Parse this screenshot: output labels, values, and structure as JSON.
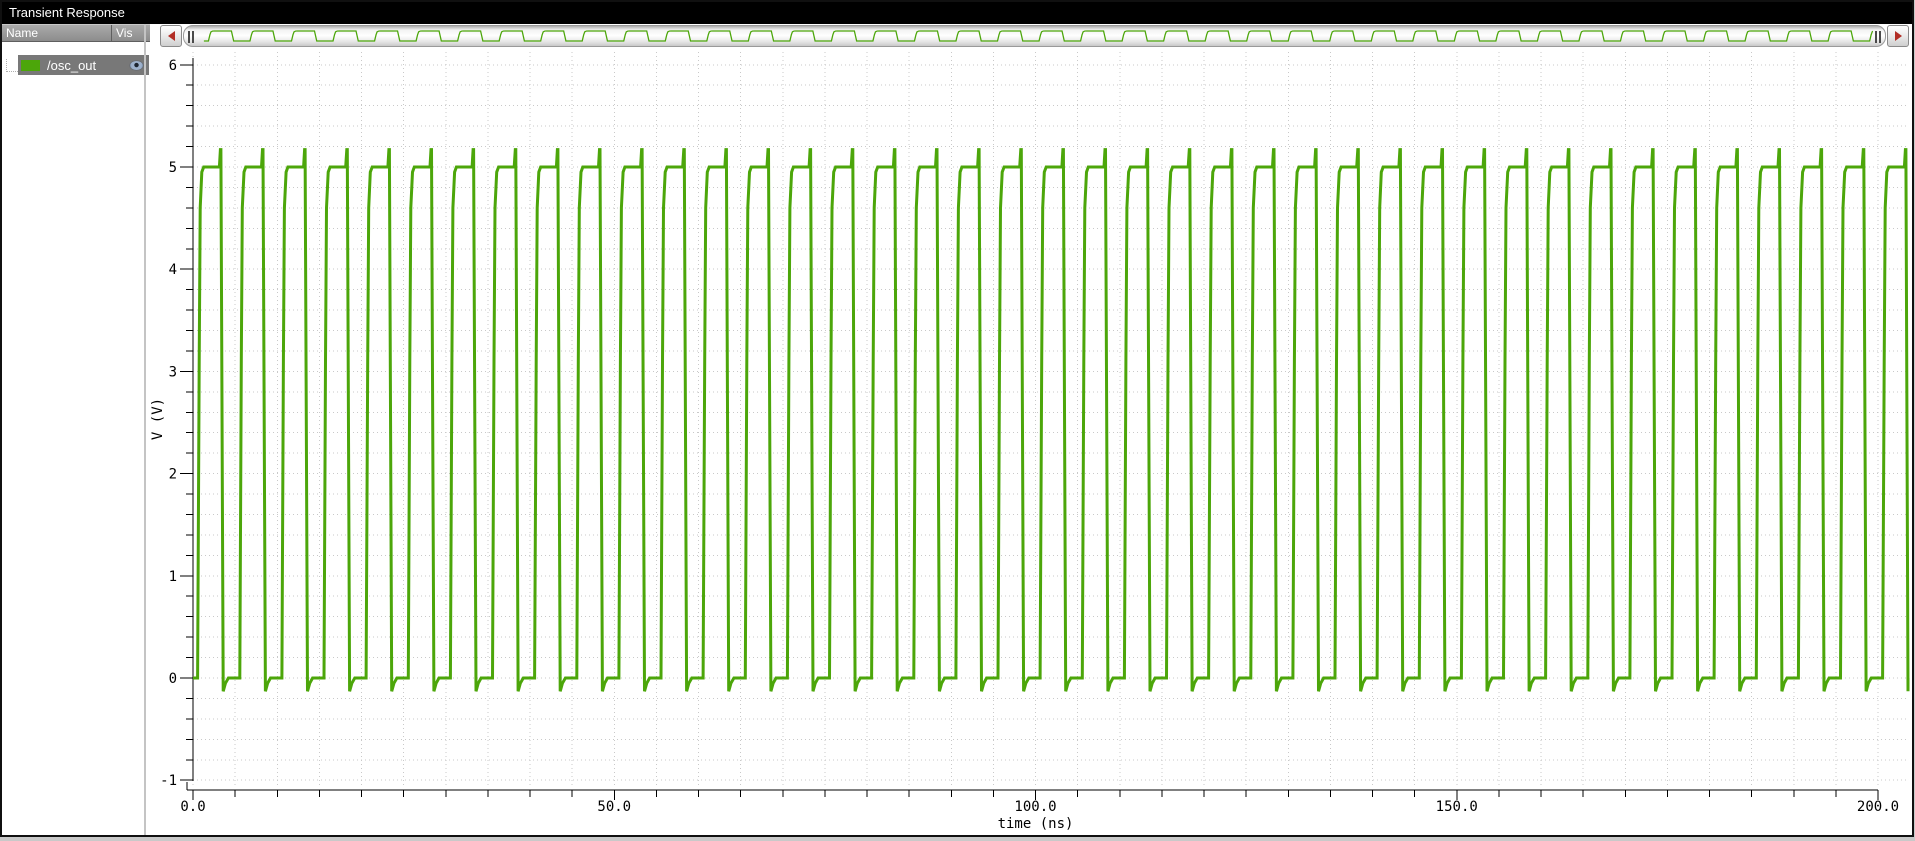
{
  "window": {
    "title": "Transient Response"
  },
  "panel": {
    "columns": [
      {
        "label": "Name"
      },
      {
        "label": "Vis"
      }
    ],
    "signals": [
      {
        "name": "/osc_out",
        "color": "#4CA60A",
        "visible": true,
        "selected": true,
        "selection_color": "#787878"
      }
    ]
  },
  "overview": {
    "description": "full-range signal preview scrollbar",
    "arrow_color": "#B22D25",
    "left_arrow_icon": "scroll-left-arrow",
    "right_arrow_icon": "scroll-right-arrow"
  },
  "chart_data": {
    "type": "line",
    "title": "Transient Response",
    "xlabel": "time (ns)",
    "ylabel": "V (V)",
    "xlim": [
      0,
      200
    ],
    "ylim": [
      -1,
      6
    ],
    "x_major_ticks": [
      0,
      50,
      100,
      150,
      200
    ],
    "x_major_tick_labels": [
      "0.0",
      "50.0",
      "100.0",
      "150.0",
      "200.0"
    ],
    "x_minor_step_ns": 5,
    "y_major_ticks": [
      -1,
      0,
      1,
      2,
      3,
      4,
      5,
      6
    ],
    "y_major_tick_labels": [
      "-1",
      "0",
      "1",
      "2",
      "3",
      "4",
      "5",
      "6"
    ],
    "y_minor_step_v": 0.2,
    "grid": "dotted minor grid, light gray",
    "series": [
      {
        "name": "/osc_out",
        "color": "#4CA60A",
        "waveform": {
          "shape": "square",
          "period_ns": 5.0,
          "first_rise_ns": 0.55,
          "high_width_ns": 2.7,
          "low_v": 0.0,
          "high_v": 5.0,
          "overshoot_peak_v": 5.17,
          "undershoot_min_v": -0.13,
          "rise_ns": 0.7,
          "fall_ns": 0.45,
          "start_v": 0.0,
          "t_start_ns": 0.0,
          "t_end_ns": 203.6,
          "cycles_visible": 40
        }
      }
    ]
  }
}
